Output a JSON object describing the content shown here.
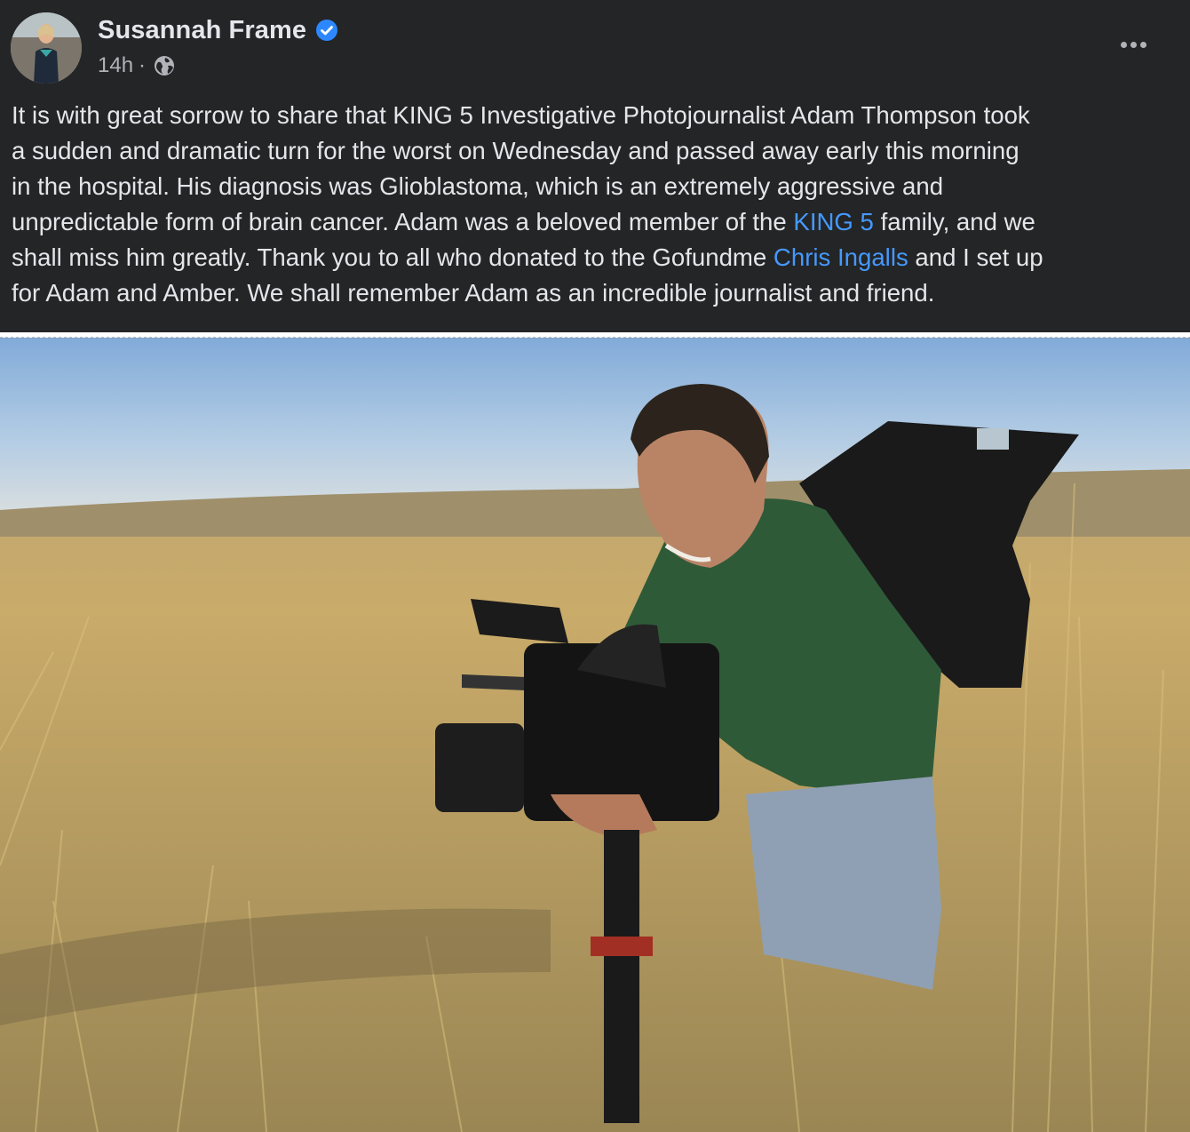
{
  "post": {
    "author": "Susannah Frame",
    "timestamp": "14h",
    "separator": "·",
    "verified": true,
    "privacy_icon": "globe-icon",
    "more_icon": "more-options-icon",
    "text": {
      "line1": "It is with great sorrow to share that KING 5 Investigative Photojournalist Adam Thompson took",
      "line2": "a sudden and dramatic turn for the worst on Wednesday and passed away early this morning",
      "line3": "in the hospital. His diagnosis was Glioblastoma, which is an extremely aggressive and",
      "line4_a": "unpredictable form of brain cancer. Adam was a beloved member of the ",
      "line4_mention": "KING 5",
      "line4_b": " family, and we",
      "line5_a": "shall miss him greatly. Thank you to all who donated to the Gofundme ",
      "line5_mention": "Chris Ingalls",
      "line5_b": " and I set up",
      "line6": "for Adam and Amber. We shall remember Adam as an incredible journalist and friend."
    },
    "mention_color": "#4599ff",
    "photo": {
      "icon": "photo-image"
    }
  }
}
